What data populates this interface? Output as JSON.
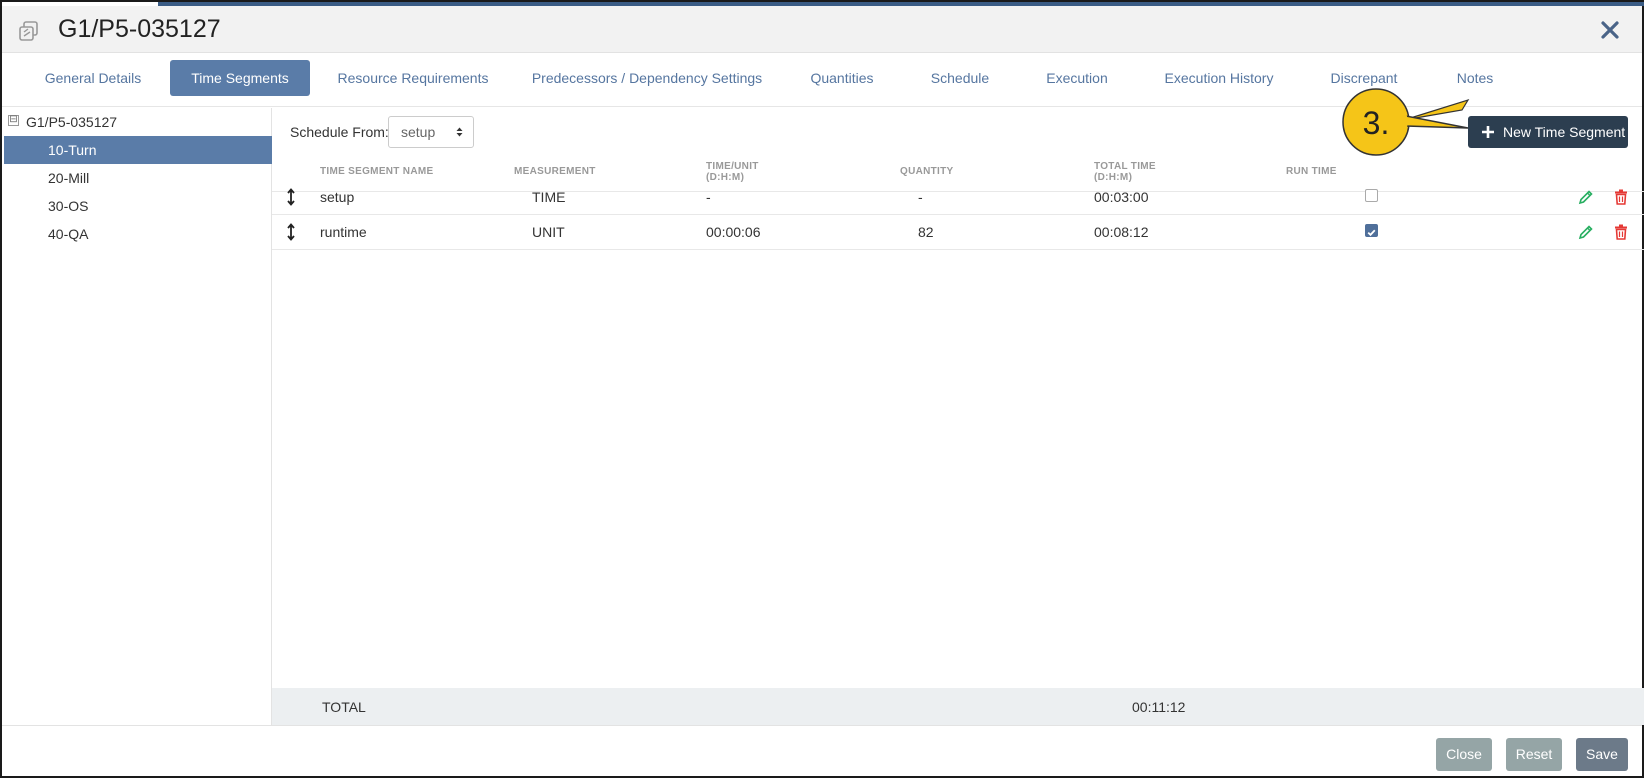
{
  "window": {
    "title": "G1/P5-035127"
  },
  "tabs": [
    {
      "label": "General Details",
      "active": false
    },
    {
      "label": "Time Segments",
      "active": true
    },
    {
      "label": "Resource Requirements",
      "active": false
    },
    {
      "label": "Predecessors / Dependency Settings",
      "active": false
    },
    {
      "label": "Quantities",
      "active": false
    },
    {
      "label": "Schedule",
      "active": false
    },
    {
      "label": "Execution",
      "active": false
    },
    {
      "label": "Execution History",
      "active": false
    },
    {
      "label": "Discrepant",
      "active": false
    },
    {
      "label": "Notes",
      "active": false
    }
  ],
  "tree": {
    "root_label": "G1/P5-035127",
    "root_toggle": "⊟",
    "items": [
      {
        "label": "10-Turn",
        "selected": true
      },
      {
        "label": "20-Mill",
        "selected": false
      },
      {
        "label": "30-OS",
        "selected": false
      },
      {
        "label": "40-QA",
        "selected": false
      }
    ]
  },
  "toolbar": {
    "schedule_from_label": "Schedule From:",
    "schedule_from_value": "setup",
    "new_button_label": "New Time Segment",
    "callout_text": "3."
  },
  "table": {
    "headers": {
      "name": "TIME SEGMENT NAME",
      "measurement": "MEASUREMENT",
      "time_unit_line1": "TIME/UNIT",
      "time_unit_line2": "(D:H:M)",
      "quantity": "QUANTITY",
      "total_time_line1": "TOTAL TIME",
      "total_time_line2": "(D:H:M)",
      "run_time": "RUN TIME"
    },
    "rows": [
      {
        "name": "setup",
        "measurement": "TIME",
        "time_unit": "-",
        "quantity": "-",
        "total_time": "00:03:00",
        "run_time": false
      },
      {
        "name": "runtime",
        "measurement": "UNIT",
        "time_unit": "00:00:06",
        "quantity": "82",
        "total_time": "00:08:12",
        "run_time": true
      }
    ],
    "total_label": "TOTAL",
    "total_value": "00:11:12"
  },
  "footer": {
    "close_label": "Close",
    "reset_label": "Reset",
    "save_label": "Save"
  },
  "colors": {
    "accent": "#5a7ca8",
    "dark_button": "#2c3e50",
    "edit_icon": "#27ae60",
    "delete_icon": "#e74c3c",
    "callout": "#f5c518"
  }
}
